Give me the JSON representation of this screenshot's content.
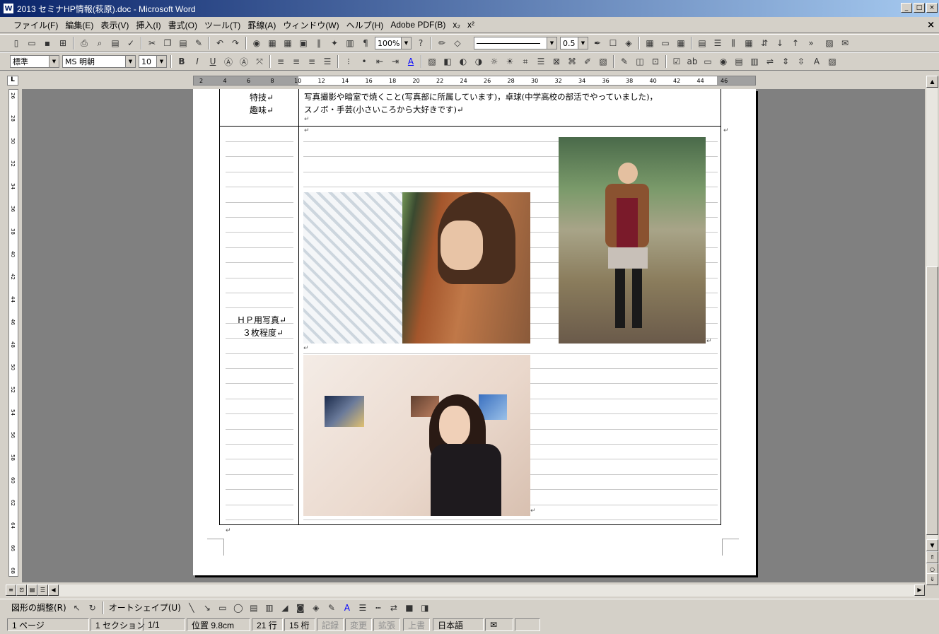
{
  "window": {
    "title": "2013 セミナHP情報(萩原).doc - Microsoft Word",
    "min": "_",
    "max": "□",
    "close": "×"
  },
  "menu": {
    "items": [
      "ファイル(F)",
      "編集(E)",
      "表示(V)",
      "挿入(I)",
      "書式(O)",
      "ツール(T)",
      "罫線(A)",
      "ウィンドウ(W)",
      "ヘルプ(H)",
      "Adobe PDF(B)",
      "x₂",
      "x²"
    ],
    "close": "×"
  },
  "toolbar1": {
    "zoom": "100%",
    "line_weight": "0.5"
  },
  "toolbar2": {
    "style": "標準",
    "font": "MS 明朝",
    "size": "10",
    "bold": "B",
    "italic": "I",
    "underline": "U",
    "font_color_label": "A"
  },
  "ruler": {
    "ticks": [
      "2",
      "4",
      "6",
      "8",
      "10",
      "12",
      "14",
      "16",
      "18",
      "20",
      "22",
      "24",
      "26",
      "28",
      "30",
      "32",
      "34",
      "36",
      "38",
      "40",
      "42",
      "44",
      "46"
    ],
    "vticks": [
      "26",
      "28",
      "30",
      "32",
      "34",
      "36",
      "38",
      "40",
      "42",
      "44",
      "46",
      "48",
      "50",
      "52",
      "54",
      "56",
      "58",
      "60",
      "62",
      "64",
      "66",
      "68"
    ],
    "corner": "L"
  },
  "document": {
    "row1": {
      "label1": "特技↵",
      "label2": "趣味↵",
      "text1": "写真撮影や暗室で焼くこと(写真部に所属しています)，卓球(中学高校の部活でやっていました)，",
      "text2": "スノボ・手芸(小さいころから大好きです)↵"
    },
    "row2": {
      "label1": "ＨＰ用写真↵",
      "label2": "３枚程度↵"
    },
    "para_mark": "↵"
  },
  "drawing": {
    "adjust": "図形の調整(R)",
    "autoshape": "オートシェイプ(U)"
  },
  "status": {
    "page": "1 ページ",
    "section": "1 セクション",
    "pages": "1/1",
    "position": "位置 9.8cm",
    "line": "21 行",
    "col": "15 桁",
    "rec": "記録",
    "trk": "変更",
    "ext": "拡張",
    "ovr": "上書",
    "lang": "日本語"
  }
}
